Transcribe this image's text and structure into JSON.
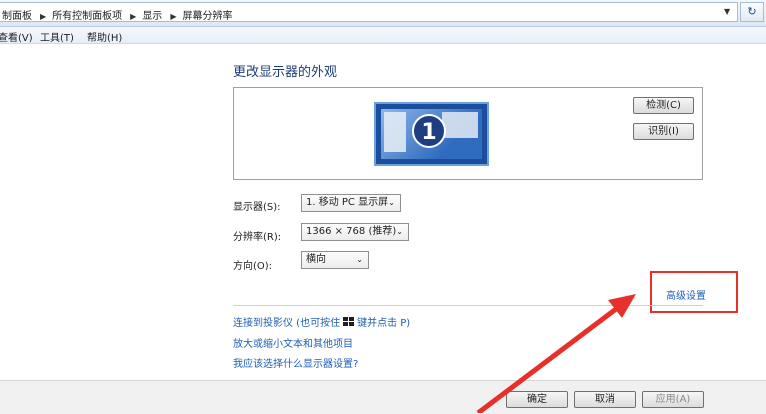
{
  "address": {
    "crumbs": [
      "制面板",
      "所有控制面板项",
      "显示",
      "屏幕分辨率"
    ],
    "dropdown_icon": "chevron-down-icon",
    "refresh_icon": "refresh-icon"
  },
  "menu": {
    "view": "查看(V)",
    "tools": "工具(T)",
    "help": "帮助(H)"
  },
  "main": {
    "title": "更改显示器的外观",
    "monitor_number": "1",
    "detect_button": "检测(C)",
    "identify_button": "识别(I)",
    "display_label": "显示器(S):",
    "display_value": "1. 移动 PC 显示屏",
    "resolution_label": "分辨率(R):",
    "resolution_value": "1366 × 768 (推荐)",
    "orientation_label": "方向(O):",
    "orientation_value": "横向",
    "advanced_link": "高级设置",
    "projector_link_prefix": "连接到投影仪 (也可按住",
    "projector_link_suffix": "键并点击 P)",
    "text_size_link": "放大或缩小文本和其他项目",
    "help_link": "我应该选择什么显示器设置?"
  },
  "footer": {
    "ok": "确定",
    "cancel": "取消",
    "apply": "应用(A)"
  },
  "colors": {
    "highlight": "#e8302a",
    "link": "#1f5fb4",
    "title": "#1e3c78"
  }
}
